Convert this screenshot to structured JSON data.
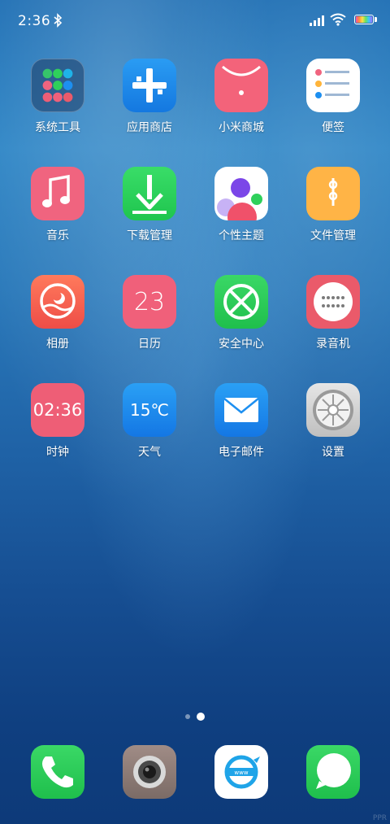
{
  "status_bar": {
    "time": "2:36",
    "icons": [
      "bluetooth-icon",
      "signal-icon",
      "wifi-icon",
      "battery-icon"
    ]
  },
  "apps": [
    {
      "label": "系统工具",
      "icon": "folder-icon"
    },
    {
      "label": "应用商店",
      "icon": "app-store-icon"
    },
    {
      "label": "小米商城",
      "icon": "mi-store-icon"
    },
    {
      "label": "便签",
      "icon": "notes-icon"
    },
    {
      "label": "音乐",
      "icon": "music-icon"
    },
    {
      "label": "下载管理",
      "icon": "download-icon"
    },
    {
      "label": "个性主题",
      "icon": "themes-icon"
    },
    {
      "label": "文件管理",
      "icon": "file-manager-icon"
    },
    {
      "label": "相册",
      "icon": "gallery-icon"
    },
    {
      "label": "日历",
      "icon": "calendar-icon"
    },
    {
      "label": "安全中心",
      "icon": "security-icon"
    },
    {
      "label": "录音机",
      "icon": "recorder-icon"
    },
    {
      "label": "时钟",
      "icon": "clock-icon"
    },
    {
      "label": "天气",
      "icon": "weather-icon"
    },
    {
      "label": "电子邮件",
      "icon": "email-icon"
    },
    {
      "label": "设置",
      "icon": "settings-icon"
    }
  ],
  "calendar_day": "23",
  "clock_time": "02:36",
  "weather_temp": "15℃",
  "page_indicator": {
    "pages": 2,
    "active": 2
  },
  "dock": [
    {
      "icon": "phone-icon"
    },
    {
      "icon": "camera-icon"
    },
    {
      "icon": "browser-icon",
      "text": "www"
    },
    {
      "icon": "messages-icon"
    }
  ],
  "watermark": "PPR",
  "colors": {
    "music": "#f0647f",
    "download": "#2fd05b",
    "gallery": "#f05a4a",
    "calendar": "#f0607a",
    "security": "#27c44f",
    "recorder": "#ea5a6a",
    "clock": "#ee5e76",
    "weather": "#1a8ff0",
    "email": "#1d8ff0"
  }
}
